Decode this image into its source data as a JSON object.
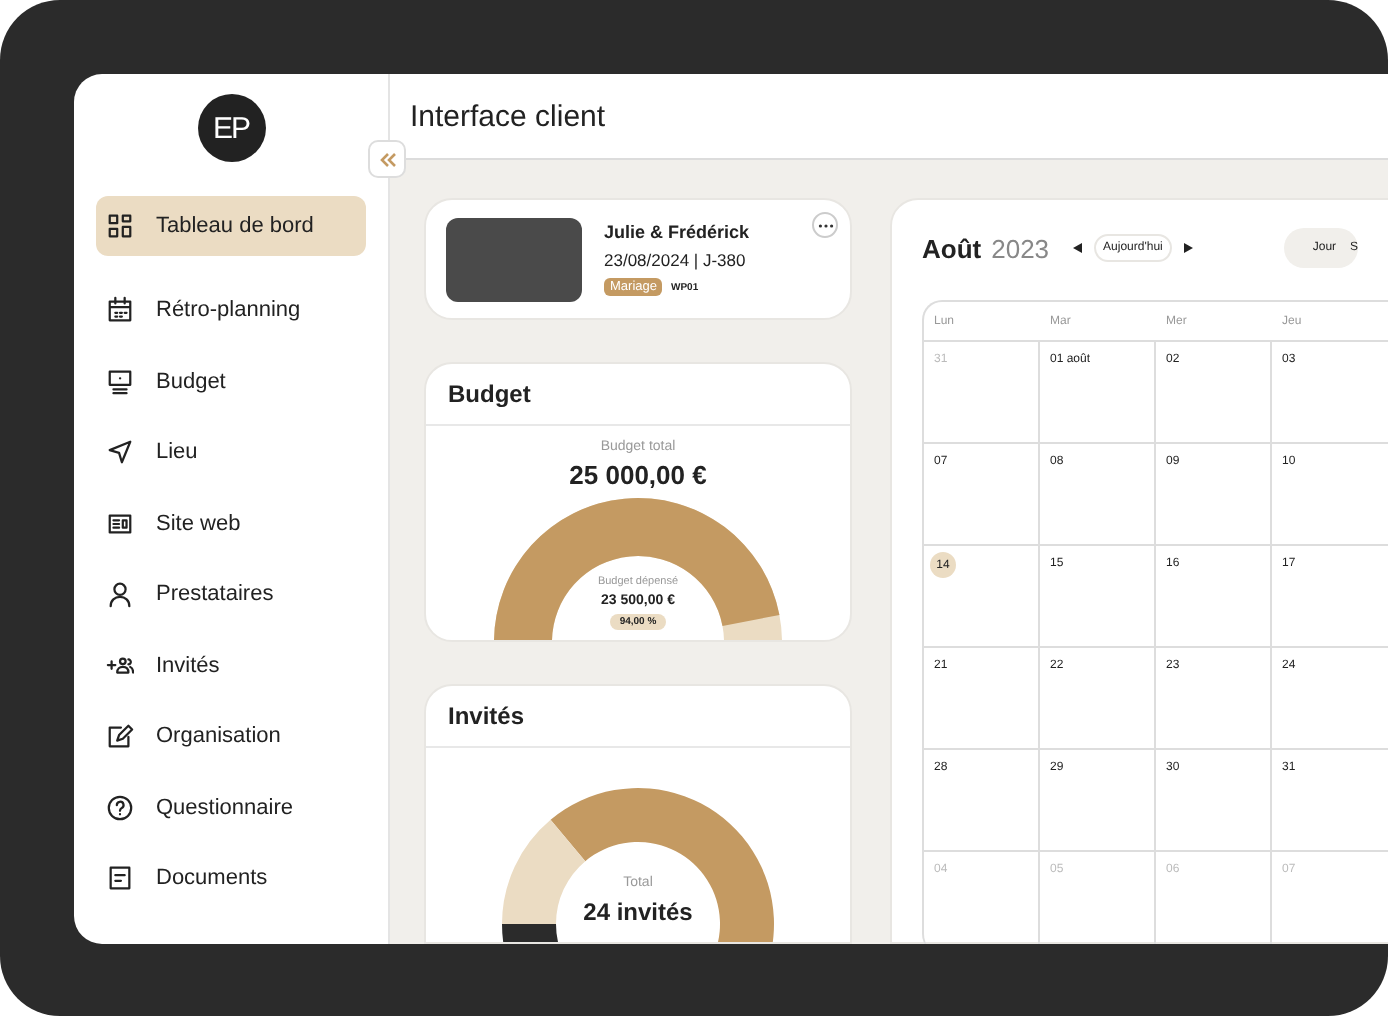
{
  "sidebar": {
    "logo": "EP",
    "items": [
      {
        "label": "Tableau de bord",
        "selected": true
      },
      {
        "label": "Rétro-planning",
        "selected": false
      },
      {
        "label": "Budget",
        "selected": false
      },
      {
        "label": "Lieu",
        "selected": false
      },
      {
        "label": "Site web",
        "selected": false
      },
      {
        "label": "Prestataires",
        "selected": false
      },
      {
        "label": "Invités",
        "selected": false
      },
      {
        "label": "Organisation",
        "selected": false
      },
      {
        "label": "Questionnaire",
        "selected": false
      },
      {
        "label": "Documents",
        "selected": false
      }
    ]
  },
  "header": {
    "title": "Interface client"
  },
  "profile": {
    "names": "Julie & Frédérick",
    "date": "23/08/2024 | J-380",
    "tag": "Mariage",
    "code": "WP01"
  },
  "budget": {
    "title": "Budget",
    "total_label": "Budget total",
    "total": "25 000,00 €",
    "spent_label": "Budget dépensé",
    "spent": "23 500,00 €",
    "percent": "94,00 %",
    "level": 0.94
  },
  "guests": {
    "title": "Invités",
    "total_label": "Total",
    "total": "24 invités"
  },
  "calendar": {
    "month": "Août",
    "year": "2023",
    "today_button": "Aujourd'hui",
    "views": [
      "Jour",
      "S"
    ],
    "weekdays": [
      "Lun",
      "Mar",
      "Mer",
      "Jeu"
    ],
    "weeks": [
      [
        {
          "label": "31",
          "outside": true,
          "today": false
        },
        {
          "label": "01 août",
          "outside": false,
          "today": false
        },
        {
          "label": "02",
          "outside": false,
          "today": false
        },
        {
          "label": "03",
          "outside": false,
          "today": false
        }
      ],
      [
        {
          "label": "07",
          "outside": false,
          "today": false
        },
        {
          "label": "08",
          "outside": false,
          "today": false
        },
        {
          "label": "09",
          "outside": false,
          "today": false
        },
        {
          "label": "10",
          "outside": false,
          "today": false
        }
      ],
      [
        {
          "label": "14",
          "outside": false,
          "today": true
        },
        {
          "label": "15",
          "outside": false,
          "today": false
        },
        {
          "label": "16",
          "outside": false,
          "today": false
        },
        {
          "label": "17",
          "outside": false,
          "today": false
        }
      ],
      [
        {
          "label": "21",
          "outside": false,
          "today": false
        },
        {
          "label": "22",
          "outside": false,
          "today": false
        },
        {
          "label": "23",
          "outside": false,
          "today": false
        },
        {
          "label": "24",
          "outside": false,
          "today": false
        }
      ],
      [
        {
          "label": "28",
          "outside": false,
          "today": false
        },
        {
          "label": "29",
          "outside": false,
          "today": false
        },
        {
          "label": "30",
          "outside": false,
          "today": false
        },
        {
          "label": "31",
          "outside": false,
          "today": false
        }
      ],
      [
        {
          "label": "04",
          "outside": true,
          "today": false
        },
        {
          "label": "05",
          "outside": true,
          "today": false
        },
        {
          "label": "06",
          "outside": true,
          "today": false
        },
        {
          "label": "07",
          "outside": true,
          "today": false
        }
      ]
    ]
  }
}
